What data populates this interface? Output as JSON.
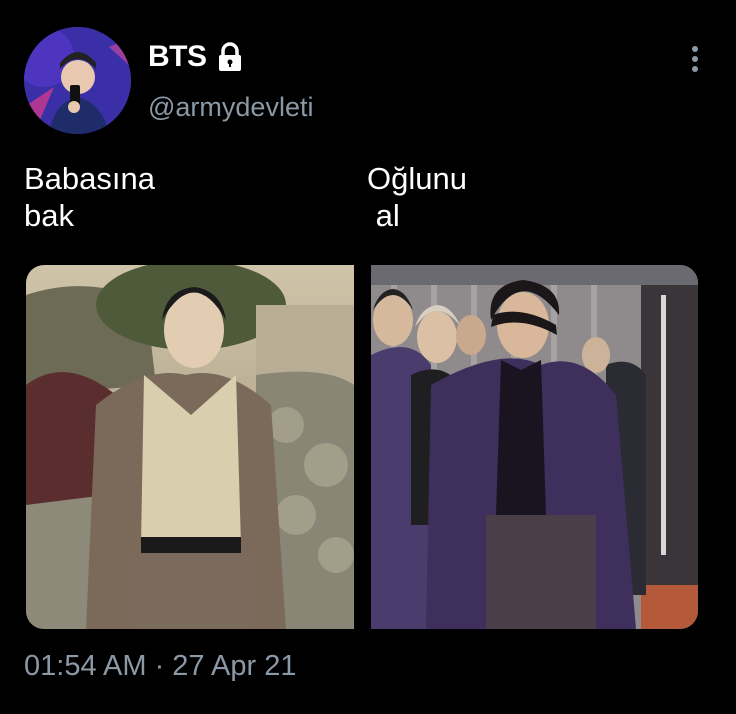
{
  "tweet": {
    "author": {
      "display_name": "BTS",
      "handle": "@armydevleti",
      "avatar_icon": "profile-avatar",
      "locked_icon": "lock-icon"
    },
    "more_icon": "more-vertical-icon",
    "caption_left": "Babasına\nbak",
    "caption_right": "Oğlunu\n al",
    "timestamp": "01:54 AM · 27 Apr 21"
  },
  "colors": {
    "background": "#000000",
    "text_primary": "#ffffff",
    "text_secondary": "#8b98a5"
  }
}
